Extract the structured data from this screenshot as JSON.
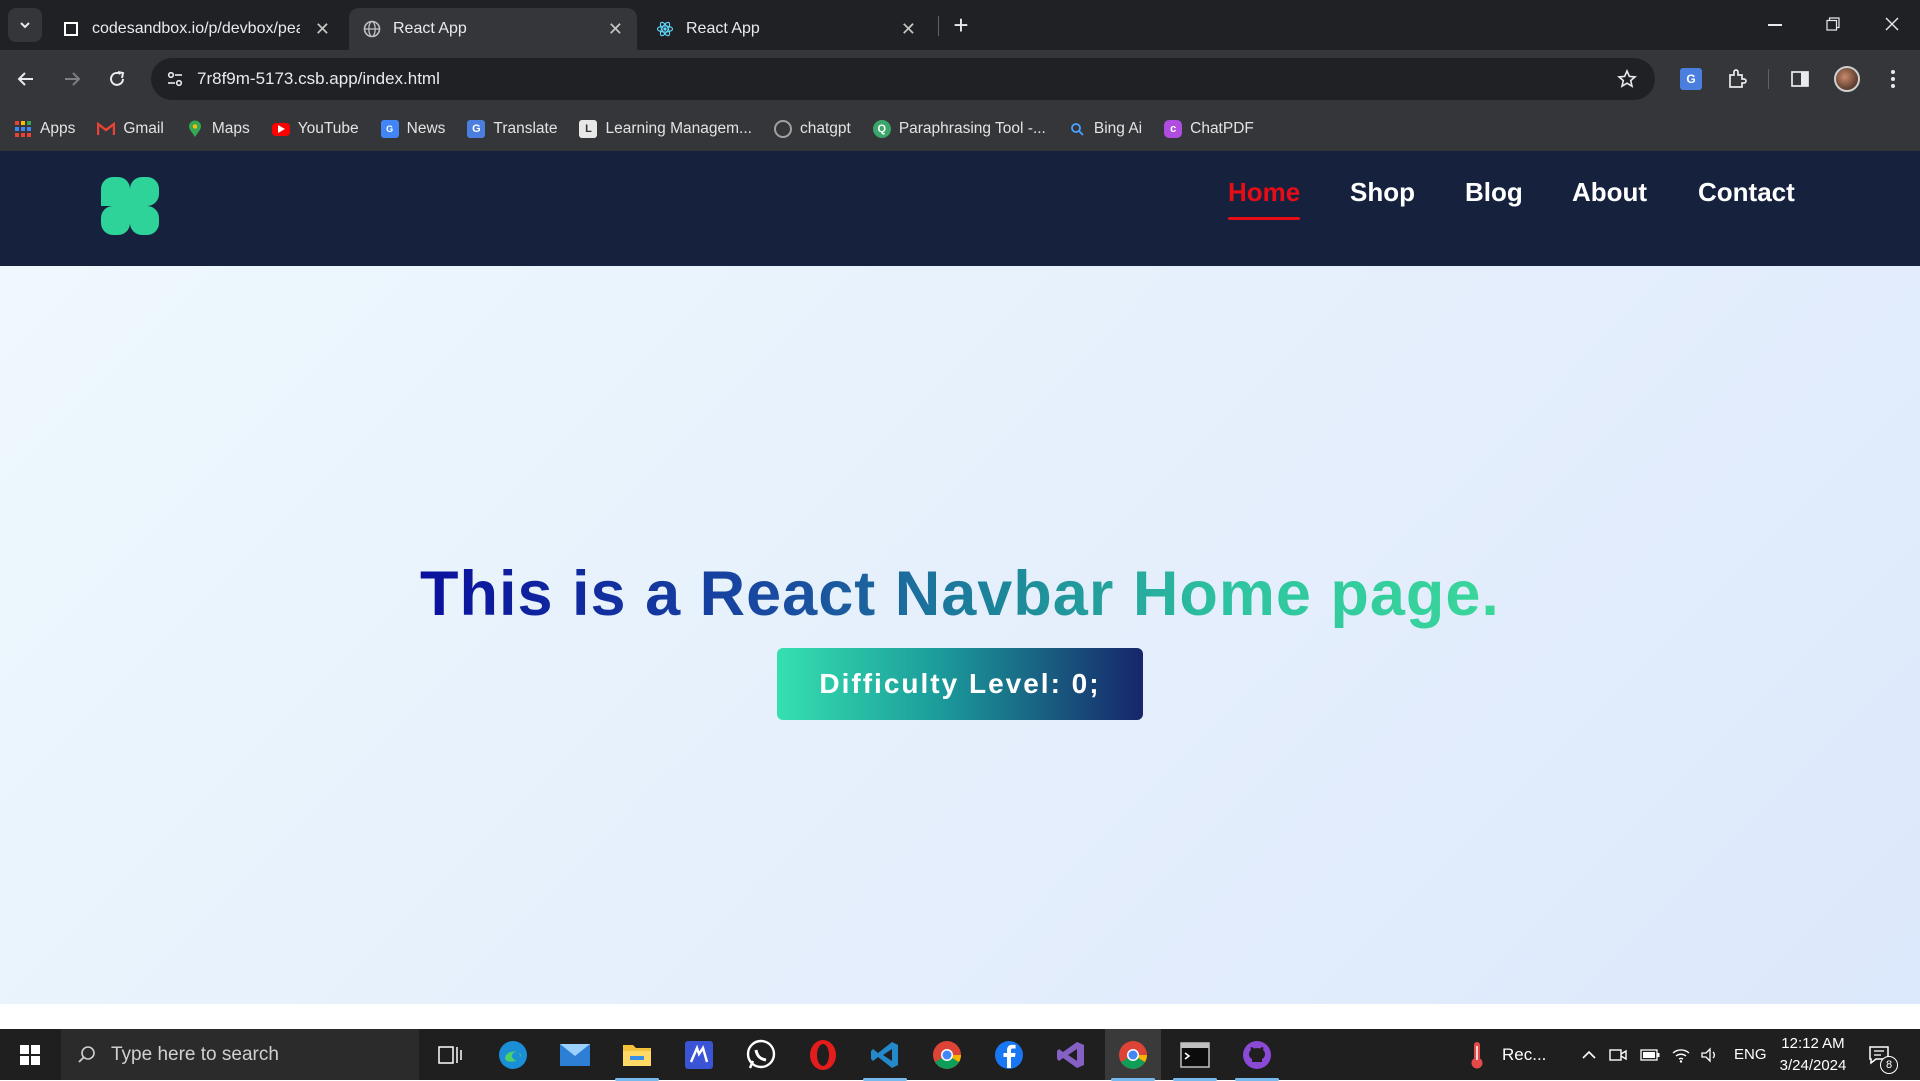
{
  "browser": {
    "tabs": [
      {
        "title": "codesandbox.io/p/devbox/peac",
        "close": "✕"
      },
      {
        "title": "React App",
        "close": "✕"
      },
      {
        "title": "React App",
        "close": "✕"
      }
    ],
    "new_tab": "+",
    "url": "7r8f9m-5173.csb.app/index.html",
    "bookmarks": [
      {
        "label": "Apps",
        "icon": "apps-grid-icon"
      },
      {
        "label": "Gmail",
        "icon": "gmail-icon"
      },
      {
        "label": "Maps",
        "icon": "maps-icon"
      },
      {
        "label": "YouTube",
        "icon": "youtube-icon"
      },
      {
        "label": "News",
        "icon": "news-icon"
      },
      {
        "label": "Translate",
        "icon": "translate-icon"
      },
      {
        "label": "Learning Managem...",
        "icon": "learning-icon"
      },
      {
        "label": "chatgpt",
        "icon": "chatgpt-icon"
      },
      {
        "label": "Paraphrasing Tool -...",
        "icon": "paraphrasing-icon"
      },
      {
        "label": "Bing Ai",
        "icon": "bing-search-icon"
      },
      {
        "label": "ChatPDF",
        "icon": "chatpdf-icon"
      }
    ]
  },
  "site": {
    "nav": {
      "items": [
        {
          "label": "Home",
          "active": true
        },
        {
          "label": "Shop",
          "active": false
        },
        {
          "label": "Blog",
          "active": false
        },
        {
          "label": "About",
          "active": false
        },
        {
          "label": "Contact",
          "active": false
        }
      ]
    },
    "hero": {
      "headline": "This is a React Navbar Home page.",
      "difficulty_button": "Difficulty Level: 0;"
    },
    "colors": {
      "navbar_bg": "#16213e",
      "active_link": "#e60d17",
      "logo": "#2ed39a"
    }
  },
  "taskbar": {
    "search_placeholder": "Type here to search",
    "weather_label": "Rec...",
    "language": "ENG",
    "time": "12:12 AM",
    "date": "3/24/2024",
    "notification_count": "8"
  }
}
